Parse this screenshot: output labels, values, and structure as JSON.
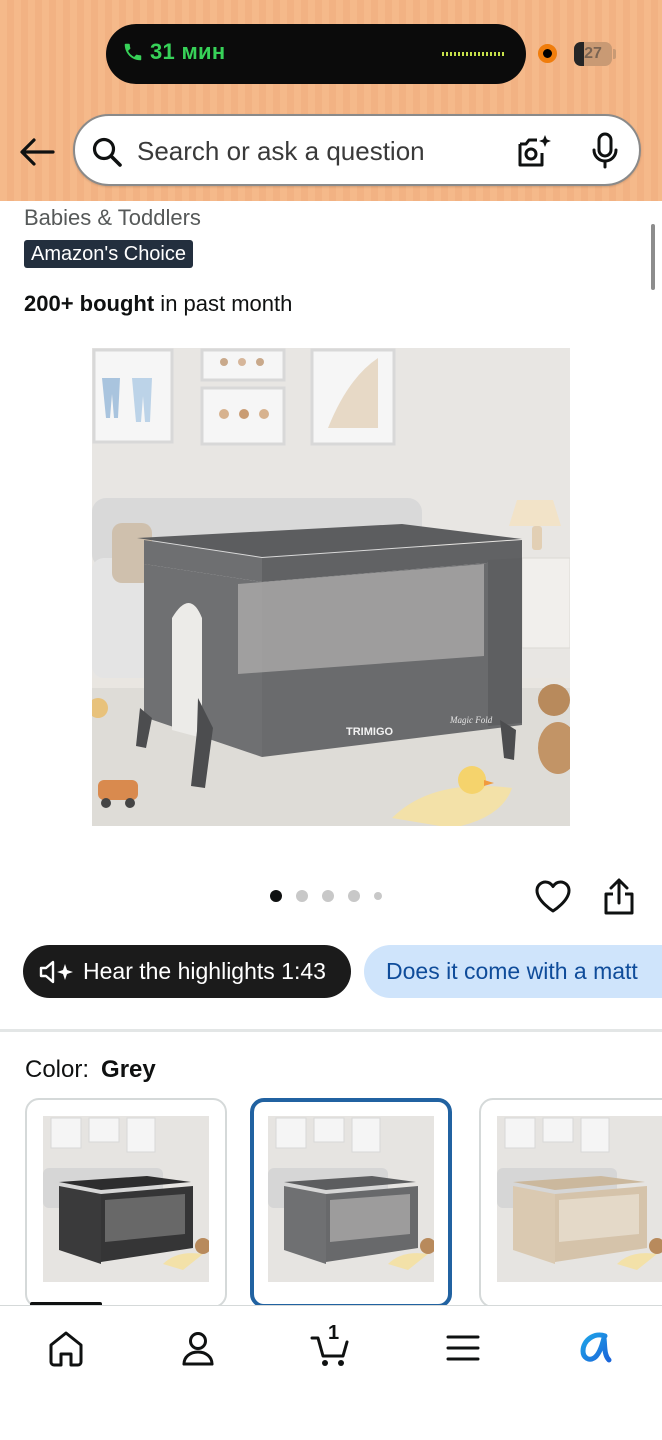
{
  "status_bar": {
    "call_time": "31 мин",
    "battery_text": "27",
    "battery_level": 0.27,
    "icons": [
      "phone-icon",
      "recording-dot-icon",
      "battery-icon"
    ]
  },
  "search": {
    "placeholder": "Search or ask a question",
    "icons": [
      "back-arrow-icon",
      "search-icon",
      "camera-lens-icon",
      "microphone-icon"
    ]
  },
  "product": {
    "breadcrumb": "Babies & Toddlers",
    "badge": "Amazon's Choice",
    "bought_strong": "200+ bought",
    "bought_rest": " in past month",
    "image_count": 5,
    "active_image": 1,
    "image_brand_text": "TRIMIGO",
    "image_script_text": "Magic Fold"
  },
  "actions": {
    "icons": [
      "heart-icon",
      "share-icon"
    ],
    "hear_highlights": "Hear the highlights 1:43",
    "question_chip": "Does it come with a matt"
  },
  "variants": {
    "label": "Color:",
    "selected_value": "Grey",
    "options": [
      {
        "frame_color": "#3a3a3a"
      },
      {
        "frame_color": "#6e6f71",
        "selected": true
      },
      {
        "frame_color": "#d8c6ae"
      }
    ]
  },
  "bottom_nav": {
    "items": [
      "home-icon",
      "account-icon",
      "cart-icon",
      "menu-icon",
      "rufus-icon"
    ],
    "cart_count": "1"
  },
  "colors": {
    "header_bg": "#f5b98a",
    "badge_bg": "#232f3e",
    "selected_border": "#2162a1",
    "chip_blue_bg": "#cfe4fb",
    "chip_blue_text": "#0f4c9a",
    "call_green": "#37d158"
  }
}
